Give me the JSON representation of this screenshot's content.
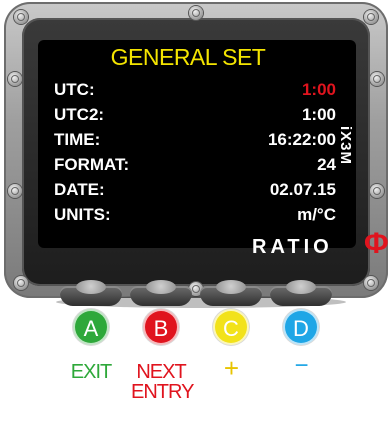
{
  "screen": {
    "title": "GENERAL SET",
    "side_label": "iX3M",
    "brand": "RATIO",
    "brand_symbol": "Φ",
    "rows": [
      {
        "label": "UTC:",
        "value": "1:00",
        "active": true
      },
      {
        "label": "UTC2:",
        "value": "1:00",
        "active": false
      },
      {
        "label": "TIME:",
        "value": "16:22:00",
        "active": false
      },
      {
        "label": "FORMAT:",
        "value": "24",
        "active": false
      },
      {
        "label": "DATE:",
        "value": "02.07.15",
        "active": false
      },
      {
        "label": "UNITS:",
        "value": "m/°C",
        "active": false
      }
    ]
  },
  "buttons": {
    "a": {
      "letter": "A",
      "label": "EXIT",
      "color": "#2ea83a"
    },
    "b": {
      "letter": "B",
      "label_line1": "NEXT",
      "label_line2": "ENTRY",
      "color": "#e0141e"
    },
    "c": {
      "letter": "C",
      "label": "+",
      "color": "#f2e21a"
    },
    "d": {
      "letter": "D",
      "label": "−",
      "color": "#1fa6e6"
    }
  },
  "colors": {
    "title": "#f4e400",
    "active_value": "#e0141e",
    "screen_bg": "#000000"
  }
}
